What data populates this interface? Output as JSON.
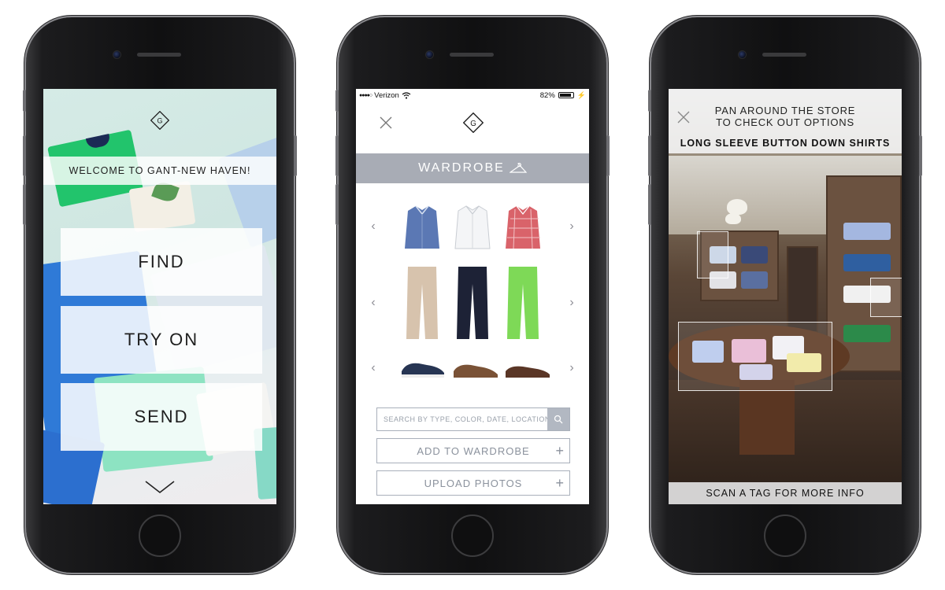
{
  "screen1": {
    "welcome": "WELCOME TO GANT-NEW HAVEN!",
    "buttons": {
      "find": "FIND",
      "try_on": "TRY ON",
      "send": "SEND"
    },
    "scroll_icon": "chevron-down-icon"
  },
  "screen2": {
    "status": {
      "carrier": "Verizon",
      "battery": "82%"
    },
    "header": "WARDROBE",
    "header_icon": "hanger-icon",
    "rows": [
      {
        "name": "shirts",
        "items": [
          "blue-oxford-shirt",
          "white-oxford-shirt",
          "red-plaid-shirt"
        ]
      },
      {
        "name": "pants",
        "items": [
          "khaki-chinos",
          "navy-chinos",
          "green-chinos"
        ]
      },
      {
        "name": "shoes",
        "items": [
          "navy-sneakers",
          "brown-suede-shoes",
          "brown-loafers"
        ]
      }
    ],
    "search": {
      "placeholder": "SEARCH BY TYPE, COLOR, DATE, LOCATION"
    },
    "actions": {
      "add": "ADD TO WARDROBE",
      "upload": "UPLOAD PHOTOS"
    }
  },
  "screen3": {
    "pan_line1": "PAN AROUND THE STORE",
    "pan_line2": "TO CHECK OUT OPTIONS",
    "category": "LONG SLEEVE BUTTON DOWN SHIRTS",
    "scan": "SCAN A TAG FOR MORE INFO"
  },
  "colors": {
    "wardrobe_header": "#a8acb5",
    "input_border": "#a9b0bb",
    "shirt_blue": "#5b78b4",
    "shirt_red": "#d9636a",
    "pant_khaki": "#d7c3ad",
    "pant_navy": "#1d2236",
    "pant_green": "#7ed957"
  }
}
